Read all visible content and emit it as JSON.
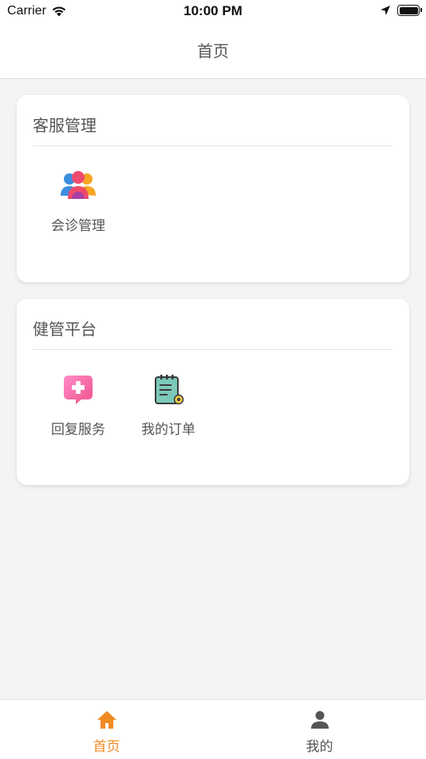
{
  "status_bar": {
    "carrier": "Carrier",
    "time": "10:00 PM",
    "battery_level": 1.0
  },
  "nav": {
    "title": "首页"
  },
  "sections": [
    {
      "title": "客服管理",
      "items": [
        {
          "label": "会诊管理",
          "icon": "people-group-icon"
        }
      ]
    },
    {
      "title": "健管平台",
      "items": [
        {
          "label": "回复服务",
          "icon": "medical-chat-icon"
        },
        {
          "label": "我的订单",
          "icon": "notepad-icon"
        }
      ]
    }
  ],
  "tab_bar": {
    "tabs": [
      {
        "label": "首页",
        "icon": "home-icon",
        "active": true
      },
      {
        "label": "我的",
        "icon": "person-icon",
        "active": false
      }
    ]
  },
  "colors": {
    "accent": "#f08a24",
    "background": "#f4f4f4",
    "card": "#ffffff",
    "text": "#555555"
  }
}
